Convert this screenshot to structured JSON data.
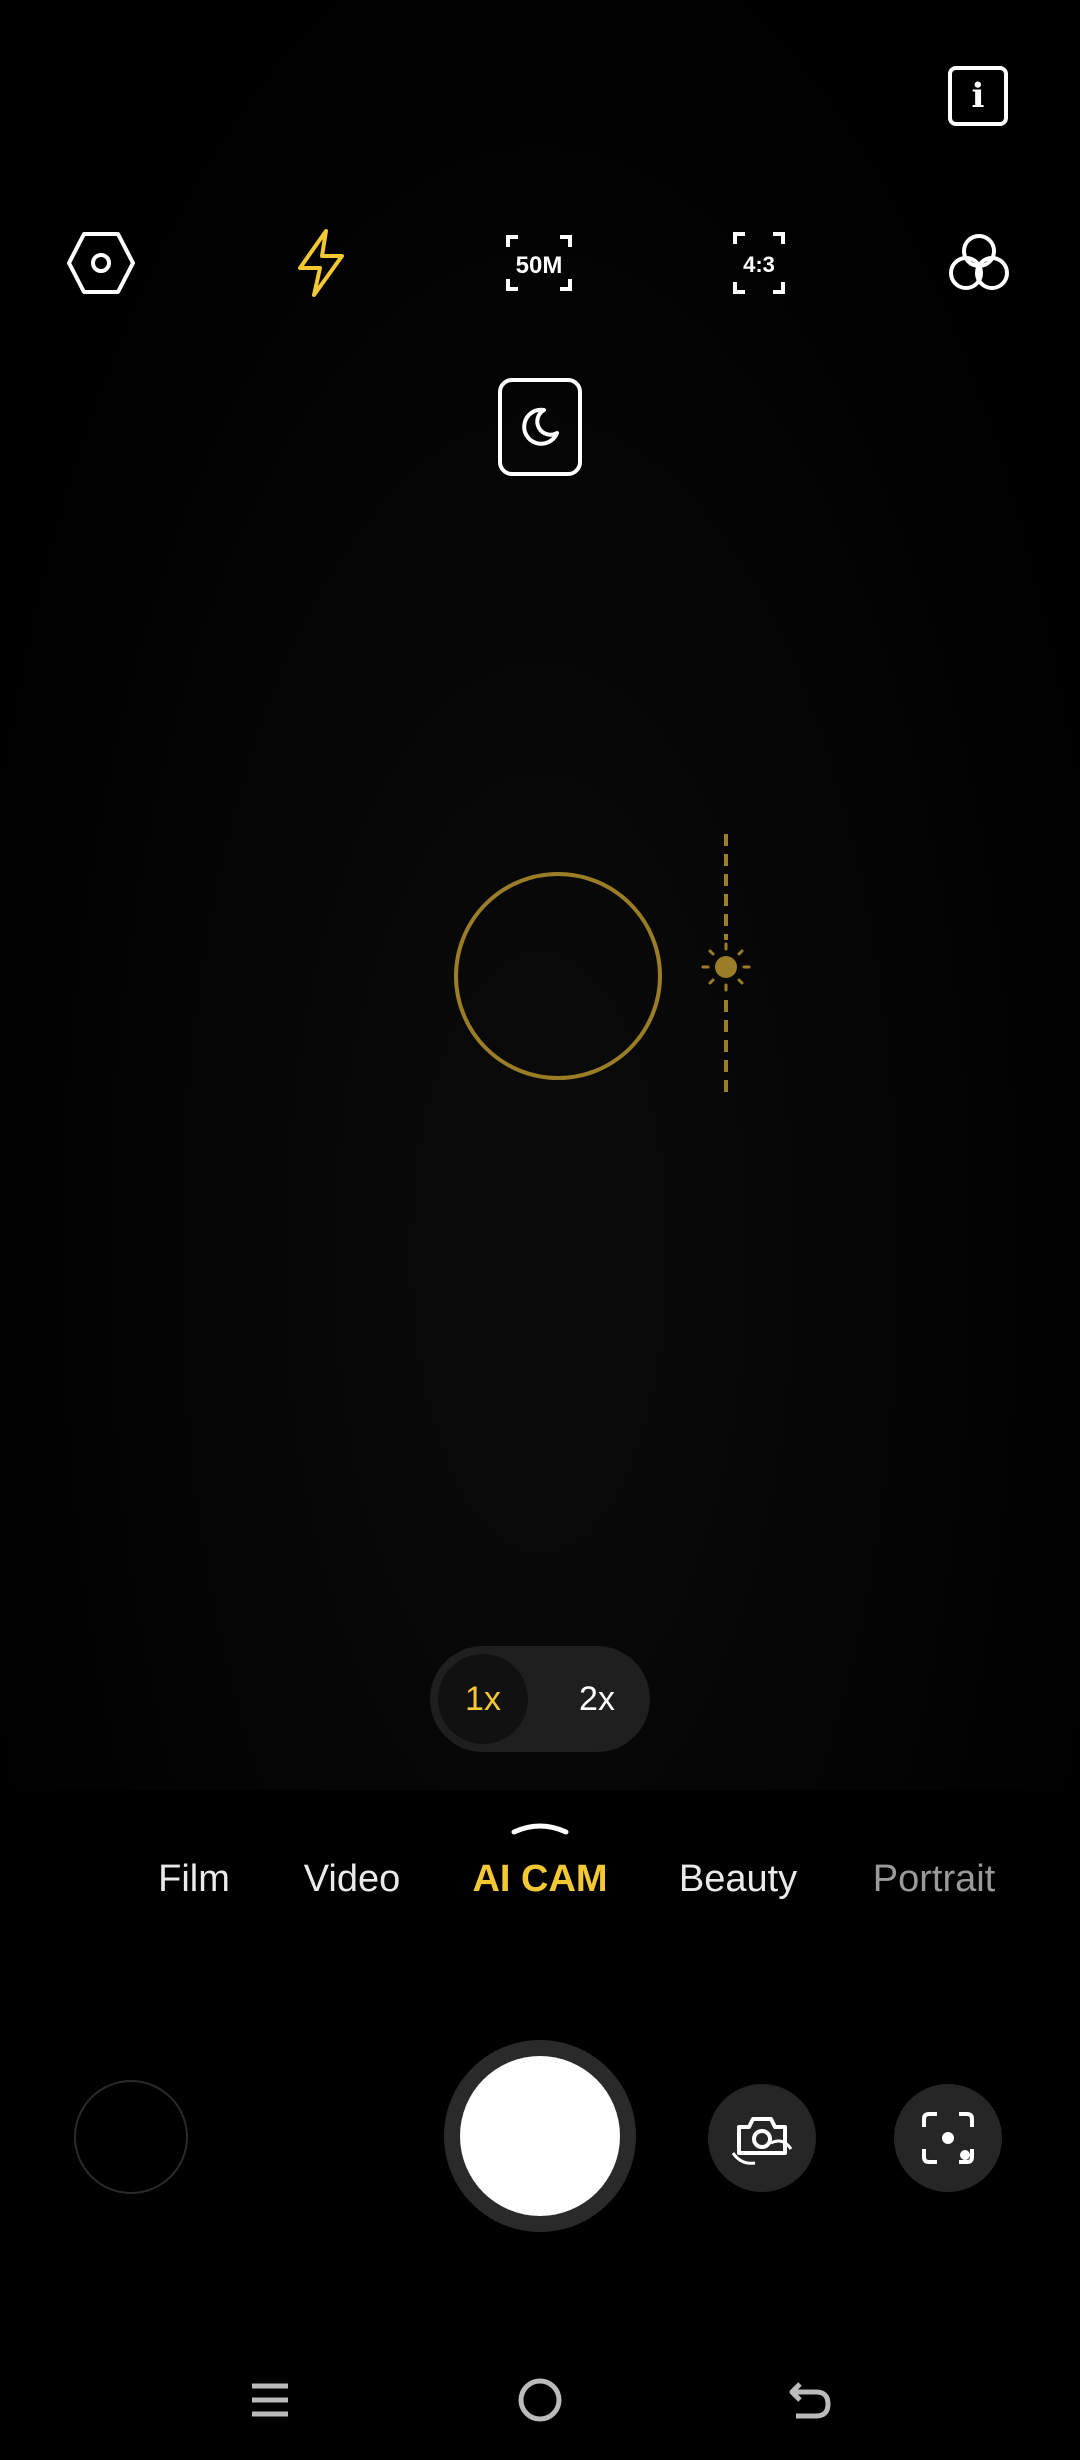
{
  "top_bar": {
    "settings_icon": "settings-hexagon-icon",
    "flash_icon": "flash-icon",
    "resolution_label": "50M",
    "aspect_ratio_label": "4:3",
    "filter_icon": "filters-icon",
    "info_label": "i",
    "night_mode_icon": "moon-icon"
  },
  "colors": {
    "accent": "#f3c832",
    "focus": "#9a7d26",
    "button_bg": "#262626"
  },
  "zoom": {
    "options": [
      {
        "label": "1x",
        "active": true
      },
      {
        "label": "2x",
        "active": false
      }
    ]
  },
  "modes": [
    {
      "label": "Film"
    },
    {
      "label": "Video"
    },
    {
      "label": "AI CAM",
      "active": true
    },
    {
      "label": "Beauty"
    },
    {
      "label": "Portrait"
    }
  ],
  "controls": {
    "gallery": "gallery-thumbnail",
    "shutter": "shutter-button",
    "switch_camera_icon": "switch-camera-icon",
    "lens_icon": "scan-lens-icon"
  },
  "nav": {
    "recents_icon": "recents-menu-icon",
    "home_icon": "home-circle-icon",
    "back_icon": "back-arrow-icon"
  }
}
